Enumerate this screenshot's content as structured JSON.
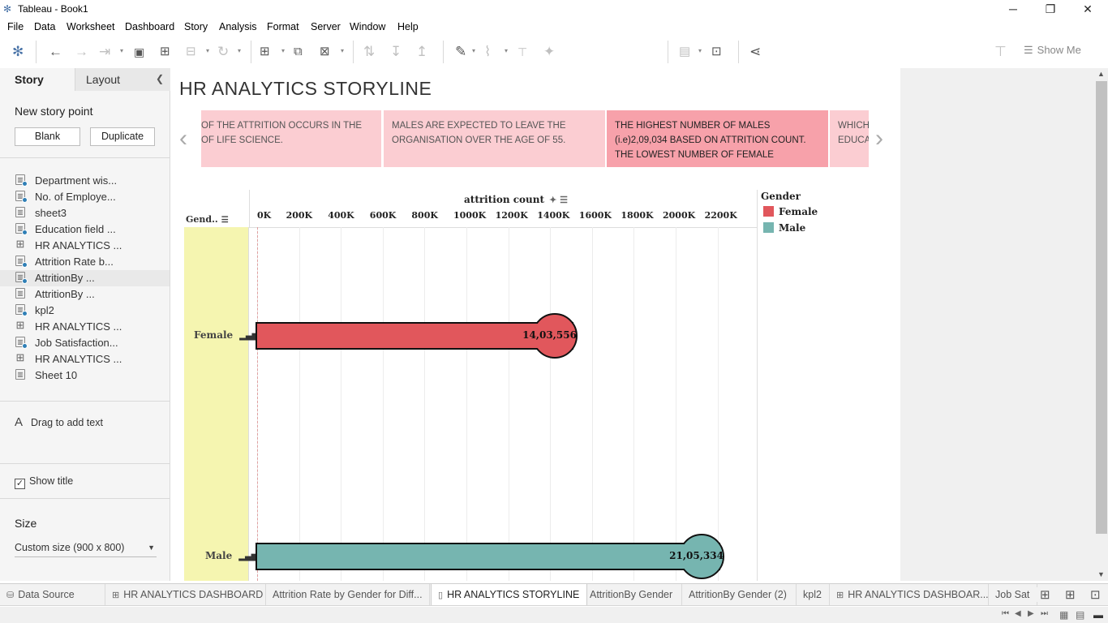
{
  "window": {
    "title": "Tableau - Book1",
    "minimize": "─",
    "restore": "❐",
    "close": "✕"
  },
  "menu": [
    "File",
    "Data",
    "Worksheet",
    "Dashboard",
    "Story",
    "Analysis",
    "Format",
    "Server",
    "Window",
    "Help"
  ],
  "toolbar": {
    "show_me": "Show Me"
  },
  "left_panel": {
    "tabs": {
      "story": "Story",
      "layout": "Layout"
    },
    "new_story_point": "New story point",
    "blank_button": "Blank",
    "duplicate_button": "Duplicate",
    "sheets": [
      {
        "name": "Department wis...",
        "type": "sheet",
        "used": true
      },
      {
        "name": "No. of Employe...",
        "type": "sheet",
        "used": true
      },
      {
        "name": "sheet3",
        "type": "sheet",
        "used": false
      },
      {
        "name": "Education field ...",
        "type": "sheet",
        "used": true
      },
      {
        "name": "HR ANALYTICS ...",
        "type": "dashboard",
        "used": false
      },
      {
        "name": "Attrition Rate b...",
        "type": "sheet",
        "used": true
      },
      {
        "name": "AttritionBy ...",
        "type": "sheet",
        "used": true
      },
      {
        "name": "AttritionBy ...",
        "type": "sheet",
        "used": false
      },
      {
        "name": "kpl2",
        "type": "sheet",
        "used": true
      },
      {
        "name": "HR ANALYTICS ...",
        "type": "dashboard",
        "used": false
      },
      {
        "name": "Job Satisfaction...",
        "type": "sheet",
        "used": true
      },
      {
        "name": "HR ANALYTICS ...",
        "type": "dashboard",
        "used": false
      },
      {
        "name": "Sheet 10",
        "type": "sheet",
        "used": false
      }
    ],
    "drag_text": "Drag to add text",
    "show_title": "Show title",
    "size_label": "Size",
    "size_value": "Custom size (900 x 800)"
  },
  "story": {
    "title": "HR ANALYTICS STORYLINE",
    "points": [
      "OF THE ATTRITION OCCURS IN THE OF LIFE SCIENCE.",
      "MALES ARE EXPECTED TO LEAVE THE ORGANISATION OVER THE AGE OF 55.",
      "THE HIGHEST NUMBER OF MALES (i.e)2,09,034 BASED ON  ATTRITION COUNT. THE LOWEST NUMBER OF FEMALE",
      "WHICH EDUCA"
    ]
  },
  "chart_data": {
    "type": "bar",
    "orientation": "horizontal",
    "title": "attrition count",
    "row_header": "Gend..",
    "categories": [
      "Female",
      "Male"
    ],
    "values": [
      1403556,
      2105334
    ],
    "data_labels": [
      "14,03,556",
      "21,05,334"
    ],
    "colors": [
      "#e1575c",
      "#76b5b0"
    ],
    "x_ticks": [
      "0K",
      "200K",
      "400K",
      "600K",
      "800K",
      "1000K",
      "1200K",
      "1400K",
      "1600K",
      "1800K",
      "2000K",
      "2200K"
    ],
    "xlim": [
      0,
      2400000
    ],
    "legend": {
      "title": "Gender",
      "entries": [
        "Female",
        "Male"
      ],
      "position": "right"
    }
  },
  "bottom_tabs": [
    {
      "label": "Data Source",
      "icon": "database-icon",
      "active": false
    },
    {
      "label": "HR ANALYTICS DASHBOARD",
      "icon": "dashboard-icon",
      "active": false
    },
    {
      "label": "Attrition Rate by Gender for Diff...",
      "icon": "",
      "active": false
    },
    {
      "label": "HR ANALYTICS STORYLINE",
      "icon": "story-icon",
      "active": true
    },
    {
      "label": "AttritionBy Gender",
      "icon": "",
      "active": false
    },
    {
      "label": "AttritionBy Gender (2)",
      "icon": "",
      "active": false
    },
    {
      "label": "kpl2",
      "icon": "",
      "active": false
    },
    {
      "label": "HR ANALYTICS DASHBOAR...",
      "icon": "dashboard-icon",
      "active": false
    },
    {
      "label": "Job Sat",
      "icon": "",
      "active": false
    }
  ]
}
